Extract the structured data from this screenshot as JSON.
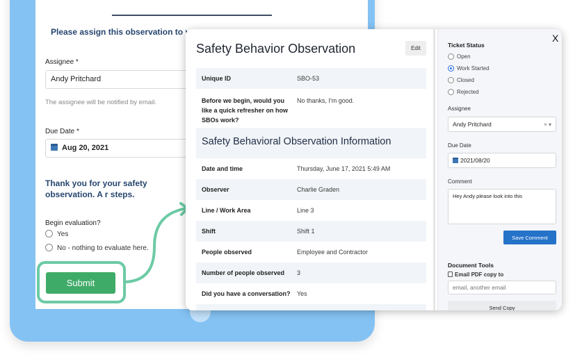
{
  "form": {
    "assign_message": "Please assign this observation to your m",
    "assignee_label": "Assignee *",
    "assignee_value": "Andy Pritchard",
    "assignee_hint": "The assignee will be notified by email.",
    "due_date_label": "Due Date *",
    "due_date_value": "Aug 20, 2021",
    "thanks_message": "Thank you for your safety observation. A r steps.",
    "begin_eval_label": "Begin evaluation?",
    "options": [
      "Yes",
      "No - nothing to evaluate here."
    ],
    "submit_label": "Submit"
  },
  "modal": {
    "title": "Safety Behavior Observation",
    "edit_label": "Edit",
    "rows_top": [
      {
        "key": "Unique ID",
        "value": "SBO-53"
      },
      {
        "key": "Before we begin, would you like a quick refresher on how SBOs work?",
        "value": "No thanks, I'm good."
      }
    ],
    "section_title": "Safety Behavioral Observation Information",
    "rows": [
      {
        "key": "Date and time",
        "value": "Thursday, June 17, 2021 5:49 AM"
      },
      {
        "key": "Observer",
        "value": "Charlie Graden"
      },
      {
        "key": "Line / Work Area",
        "value": "Line 3"
      },
      {
        "key": "Shift",
        "value": "Shift 1"
      },
      {
        "key": "People observed",
        "value": "Employee and Contractor"
      },
      {
        "key": "Number of people observed",
        "value": "3"
      },
      {
        "key": "Did you have a conversation?",
        "value": "Yes"
      }
    ]
  },
  "side": {
    "close_label": "X",
    "ticket_status_heading": "Ticket Status",
    "statuses": [
      "Open",
      "Work Started",
      "Closed",
      "Rejected"
    ],
    "selected_status": "Work Started",
    "assignee_label": "Assignee",
    "assignee_value": "Andy Pritchard",
    "assignee_controls": "× ▾",
    "due_date_label": "Due Date",
    "due_date_value": "2021/08/20",
    "comment_label": "Comment",
    "comment_value": "Hey Andy please look into this",
    "save_comment_label": "Save Comment",
    "document_tools_heading": "Document Tools",
    "email_pdf_label": "Email PDF copy to",
    "email_placeholder": "email, another email",
    "send_copy_label": "Send Copy"
  },
  "colors": {
    "tablet": "#84c2f3",
    "highlight": "#6ccaa4",
    "submit": "#3fab68",
    "primary": "#2572c9",
    "heading_text": "#27466f"
  }
}
